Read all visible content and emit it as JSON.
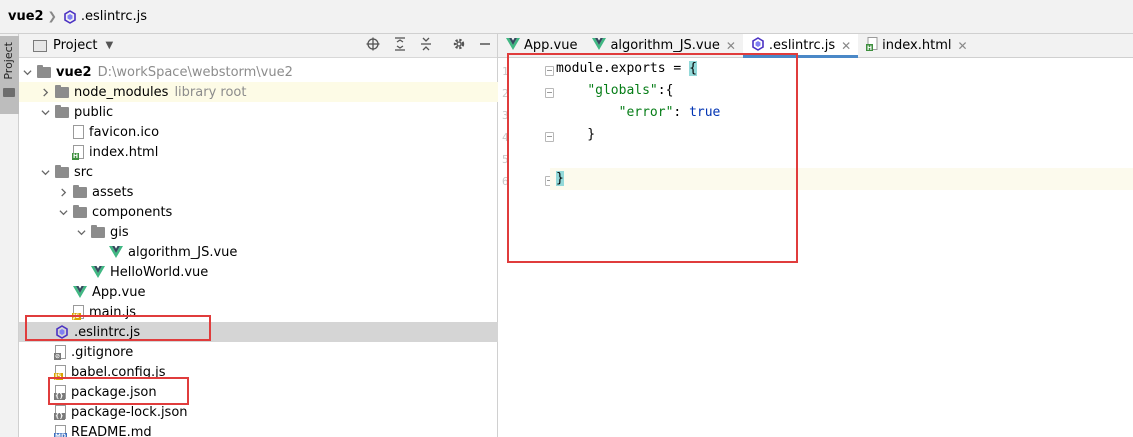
{
  "breadcrumb": {
    "root": "vue2",
    "file": ".eslintrc.js"
  },
  "toolstrip": {
    "project_tab": "Project"
  },
  "project_panel": {
    "title": "Project",
    "tree": [
      {
        "label": "vue2",
        "sub": "D:\\workSpace\\webstorm\\vue2",
        "type": "folder",
        "expand": "open"
      },
      {
        "label": "node_modules",
        "sub": "library root",
        "type": "folder",
        "expand": "closed"
      },
      {
        "label": "public",
        "sub": "",
        "type": "folder",
        "expand": "open"
      },
      {
        "label": "favicon.ico",
        "sub": "",
        "type": "file-ico",
        "expand": ""
      },
      {
        "label": "index.html",
        "sub": "",
        "type": "file-html",
        "expand": ""
      },
      {
        "label": "src",
        "sub": "",
        "type": "folder",
        "expand": "open"
      },
      {
        "label": "assets",
        "sub": "",
        "type": "folder",
        "expand": "closed"
      },
      {
        "label": "components",
        "sub": "",
        "type": "folder",
        "expand": "open"
      },
      {
        "label": "gis",
        "sub": "",
        "type": "folder",
        "expand": "open"
      },
      {
        "label": "algorithm_JS.vue",
        "sub": "",
        "type": "vue",
        "expand": ""
      },
      {
        "label": "HelloWorld.vue",
        "sub": "",
        "type": "vue",
        "expand": ""
      },
      {
        "label": "App.vue",
        "sub": "",
        "type": "vue",
        "expand": ""
      },
      {
        "label": "main.js",
        "sub": "",
        "type": "file-js",
        "expand": ""
      },
      {
        "label": ".eslintrc.js",
        "sub": "",
        "type": "eslint",
        "expand": ""
      },
      {
        "label": ".gitignore",
        "sub": "",
        "type": "file-git",
        "expand": ""
      },
      {
        "label": "babel.config.js",
        "sub": "",
        "type": "file-js",
        "expand": ""
      },
      {
        "label": "package.json",
        "sub": "",
        "type": "file-json",
        "expand": ""
      },
      {
        "label": "package-lock.json",
        "sub": "",
        "type": "file-json",
        "expand": ""
      },
      {
        "label": "README.md",
        "sub": "",
        "type": "file-md",
        "expand": ""
      }
    ]
  },
  "editor": {
    "tabs": [
      {
        "label": "App.vue",
        "icon": "vue-icon"
      },
      {
        "label": "algorithm_JS.vue",
        "icon": "vue-icon"
      },
      {
        "label": ".eslintrc.js",
        "icon": "eslint-icon"
      },
      {
        "label": "index.html",
        "icon": "html-file-icon"
      }
    ],
    "line_numbers": [
      "1",
      "2",
      "3",
      "4",
      "5",
      "6"
    ],
    "code": {
      "l1_a": "module",
      "l1_b": ".exports = ",
      "l1_c": "{",
      "l2_a": "    ",
      "l2_b": "\"globals\"",
      "l2_c": ":{",
      "l3_a": "        ",
      "l3_b": "\"error\"",
      "l3_c": ": ",
      "l3_d": "true",
      "l4": "    }",
      "l6": "}"
    }
  },
  "colors": {
    "vue_green": "#41b883",
    "vue_dark": "#35495e",
    "eslint_purple": "#4b32c3",
    "annotation_red": "#e03c3c",
    "tab_underline": "#4a88c7"
  }
}
